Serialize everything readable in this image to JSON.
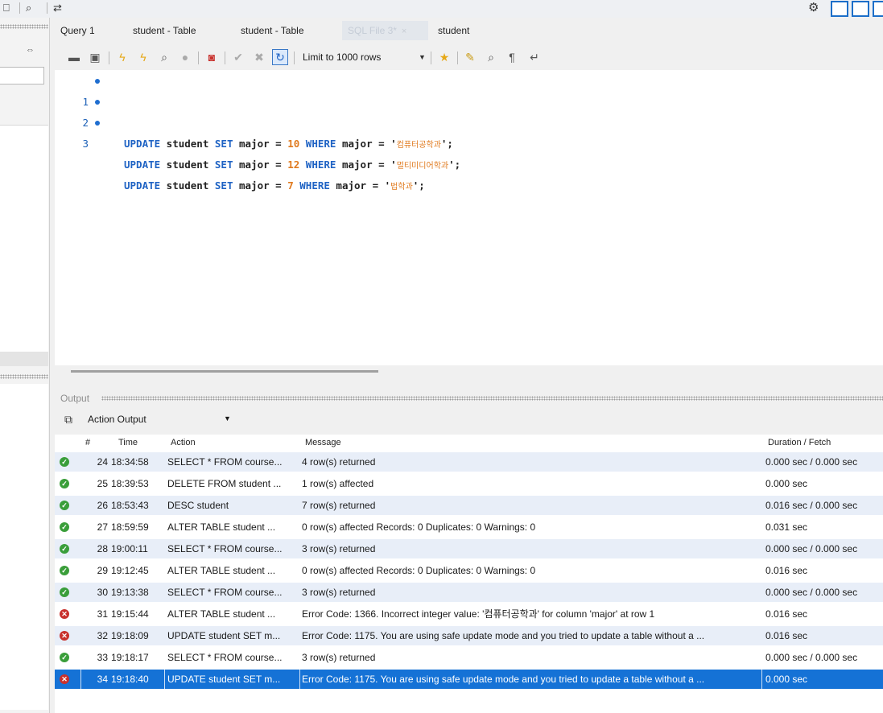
{
  "tabs": [
    {
      "label": "Query 1",
      "active": false
    },
    {
      "label": "student - Table",
      "active": false
    },
    {
      "label": "student - Table",
      "active": false
    },
    {
      "label": "SQL File 3*",
      "active": true
    },
    {
      "label": "student",
      "active": false
    }
  ],
  "toolbar": {
    "limit_label": "Limit to 1000 rows",
    "icons": [
      "folder-open-icon",
      "save-icon",
      "execute-icon",
      "execute-current-icon",
      "explain-icon",
      "stop-icon",
      "toggle-error-icon",
      "commit-icon",
      "rollback-icon",
      "autocommit-icon",
      "bookmark-icon",
      "beautify-icon",
      "find-icon",
      "invisible-chars-icon",
      "wrap-icon"
    ]
  },
  "editor": {
    "lines": [
      {
        "no": "1",
        "kw1": "UPDATE",
        "t1": " student ",
        "kw2": "SET",
        "t2": " major = ",
        "num": "10",
        "t3": " ",
        "kw3": "WHERE",
        "t4": " major = '",
        "str": "컴퓨터공학과",
        "t5": "';"
      },
      {
        "no": "2",
        "kw1": "UPDATE",
        "t1": " student ",
        "kw2": "SET",
        "t2": " major = ",
        "num": "12",
        "t3": " ",
        "kw3": "WHERE",
        "t4": " major = '",
        "str": "멀티미디어학과",
        "t5": "';"
      },
      {
        "no": "3",
        "kw1": "UPDATE",
        "t1": " student ",
        "kw2": "SET",
        "t2": " major = ",
        "num": "7",
        "t3": " ",
        "kw3": "WHERE",
        "t4": " major = '",
        "str": "법학과",
        "t5": "';"
      }
    ]
  },
  "output": {
    "label": "Output",
    "selector": "Action Output",
    "columns": {
      "num": "#",
      "time": "Time",
      "action": "Action",
      "message": "Message",
      "duration": "Duration / Fetch"
    },
    "rows": [
      {
        "status": "ok",
        "num": "24",
        "time": "18:34:58",
        "action": "SELECT * FROM course...",
        "message": "4 row(s) returned",
        "duration": "0.000 sec / 0.000 sec"
      },
      {
        "status": "ok",
        "num": "25",
        "time": "18:39:53",
        "action": "DELETE FROM student ...",
        "message": "1 row(s) affected",
        "duration": "0.000 sec"
      },
      {
        "status": "ok",
        "num": "26",
        "time": "18:53:43",
        "action": "DESC student",
        "message": "7 row(s) returned",
        "duration": "0.016 sec / 0.000 sec"
      },
      {
        "status": "ok",
        "num": "27",
        "time": "18:59:59",
        "action": "ALTER TABLE student ...",
        "message": "0 row(s) affected Records: 0  Duplicates: 0  Warnings: 0",
        "duration": "0.031 sec"
      },
      {
        "status": "ok",
        "num": "28",
        "time": "19:00:11",
        "action": "SELECT * FROM course...",
        "message": "3 row(s) returned",
        "duration": "0.000 sec / 0.000 sec"
      },
      {
        "status": "ok",
        "num": "29",
        "time": "19:12:45",
        "action": "ALTER TABLE student  ...",
        "message": "0 row(s) affected Records: 0  Duplicates: 0  Warnings: 0",
        "duration": "0.016 sec"
      },
      {
        "status": "ok",
        "num": "30",
        "time": "19:13:38",
        "action": "SELECT * FROM course...",
        "message": "3 row(s) returned",
        "duration": "0.000 sec / 0.000 sec"
      },
      {
        "status": "err",
        "num": "31",
        "time": "19:15:44",
        "action": "ALTER TABLE student ...",
        "message": "Error Code: 1366. Incorrect integer value: '컴퓨터공학과' for column 'major' at row 1",
        "duration": "0.016 sec"
      },
      {
        "status": "err",
        "num": "32",
        "time": "19:18:09",
        "action": "UPDATE student SET m...",
        "message": "Error Code: 1175. You are using safe update mode and you tried to update a table without a ...",
        "duration": "0.016 sec"
      },
      {
        "status": "ok",
        "num": "33",
        "time": "19:18:17",
        "action": "SELECT * FROM course...",
        "message": "3 row(s) returned",
        "duration": "0.000 sec / 0.000 sec"
      },
      {
        "status": "err",
        "num": "34",
        "time": "19:18:40",
        "action": "UPDATE student SET m...",
        "message": "Error Code: 1175. You are using safe update mode and you tried to update a table without a ...",
        "duration": "0.000 sec",
        "selected": true
      }
    ]
  },
  "colors": {
    "accent": "#1572d6",
    "ok": "#3a9e3a",
    "error": "#c8302c",
    "keyword": "#1f63c4",
    "literal": "#e07a1e"
  }
}
